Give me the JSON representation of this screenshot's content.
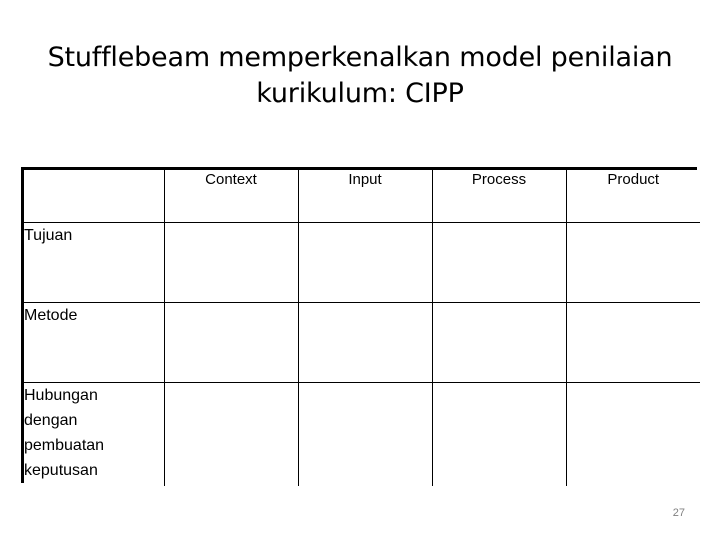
{
  "slide": {
    "title": "Stufflebeam memperkenalkan model penilaian\nkurikulum: CIPP",
    "page_number": "27",
    "background_color": "#ffffff",
    "text_color": "#000000",
    "page_number_color": "#808080"
  },
  "matrix": {
    "corner_label": "",
    "column_headers": [
      "Context",
      "Input",
      "Process",
      "Product"
    ],
    "rows": [
      {
        "label": "Tujuan",
        "cells": [
          "",
          "",
          "",
          ""
        ]
      },
      {
        "label": "Metode",
        "cells": [
          "",
          "",
          "",
          ""
        ]
      },
      {
        "label": "Hubungan\ndengan\npembuatan\nkeputusan",
        "cells": [
          "",
          "",
          "",
          ""
        ]
      }
    ]
  }
}
